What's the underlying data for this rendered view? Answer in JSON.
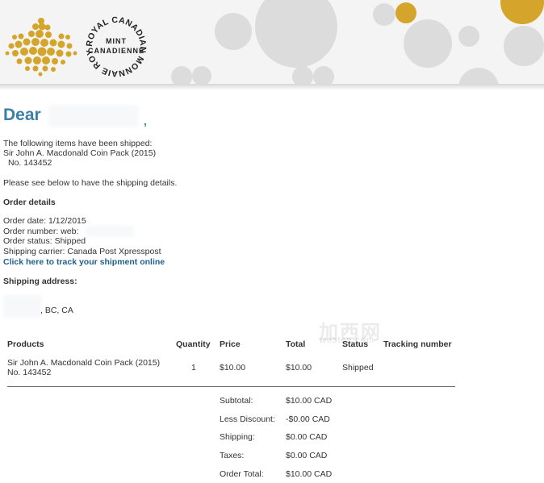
{
  "brand": {
    "seal_outer_text": "ROYAL CANADIAN MONNAIE ROYALE",
    "seal_inner_text": "MINT CANADIENNE",
    "colors": {
      "gold": "#d4a52a",
      "grey": "#d2d2d2",
      "heading_blue": "#3c7fa6",
      "link": "#1f5f8b"
    }
  },
  "greeting": {
    "word": "Dear",
    "comma": ","
  },
  "intro": {
    "line1": "The following items have been shipped:",
    "line2": "Sir John A. Macdonald Coin Pack (2015)",
    "line3": "No. 143452",
    "line4": "Please see below to have the shipping details."
  },
  "order_details": {
    "heading": "Order details",
    "date": "Order date: 1/12/2015",
    "number": "Order number: web:",
    "status": "Order status: Shipped",
    "carrier": "Shipping carrier:  Canada Post Xpresspost",
    "track_link": "Click here to track your shipment online"
  },
  "shipping_address": {
    "heading": "Shipping address:",
    "line": ", BC, CA"
  },
  "table": {
    "headers": [
      "Products",
      "Quantity",
      "Price",
      "Total",
      "Status",
      "Tracking number"
    ],
    "row": {
      "product_line1": "Sir John A. Macdonald Coin Pack (2015)",
      "product_line2": "No. 143452",
      "quantity": "1",
      "price": "$10.00",
      "total": "$10.00",
      "status": "Shipped"
    }
  },
  "summary": [
    {
      "label": "Subtotal:",
      "value": "$10.00 CAD"
    },
    {
      "label": "Less Discount:",
      "value": "-$0.00 CAD"
    },
    {
      "label": "Shipping:",
      "value": "$0.00 CAD"
    },
    {
      "label": "Taxes:",
      "value": "$0.00 CAD"
    },
    {
      "label": "Order Total:",
      "value": "$10.00 CAD"
    }
  ]
}
